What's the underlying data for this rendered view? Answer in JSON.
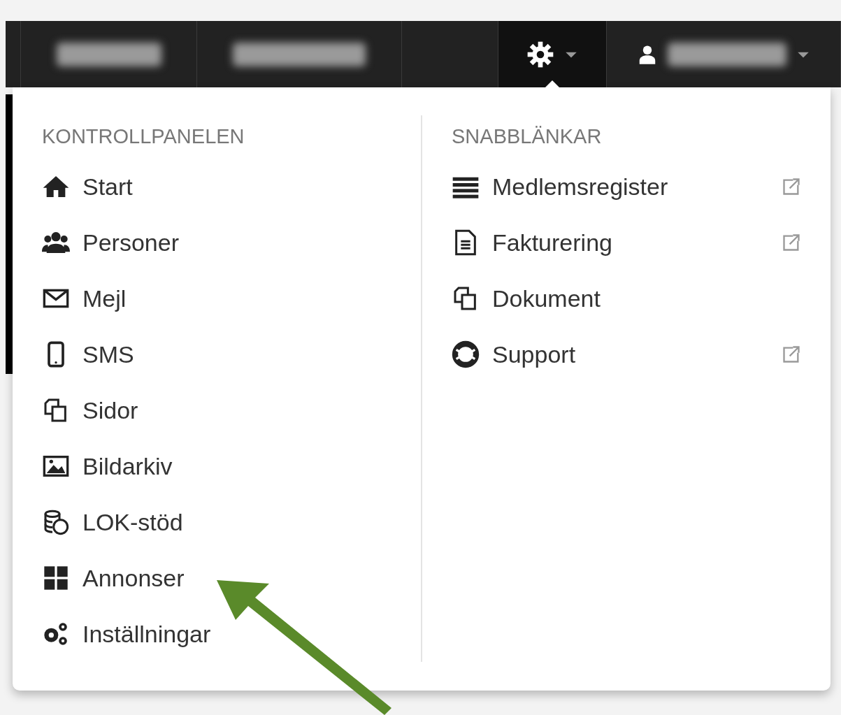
{
  "navbar": {
    "items": [
      {
        "kind": "blurred",
        "selected": false
      },
      {
        "kind": "blurred",
        "selected": false
      },
      {
        "kind": "empty",
        "selected": false
      },
      {
        "kind": "gear",
        "selected": true
      },
      {
        "kind": "user",
        "selected": false
      }
    ]
  },
  "dropdown": {
    "columns": [
      {
        "heading": "KONTROLLPANELEN",
        "items": [
          {
            "label": "Start"
          },
          {
            "label": "Personer"
          },
          {
            "label": "Mejl"
          },
          {
            "label": "SMS"
          },
          {
            "label": "Sidor"
          },
          {
            "label": "Bildarkiv"
          },
          {
            "label": "LOK-stöd"
          },
          {
            "label": "Annonser"
          },
          {
            "label": "Inställningar"
          }
        ]
      },
      {
        "heading": "SNABBLÄNKAR",
        "items": [
          {
            "label": "Medlemsregister",
            "external": true
          },
          {
            "label": "Fakturering",
            "external": true
          },
          {
            "label": "Dokument",
            "external": false
          },
          {
            "label": "Support",
            "external": true
          }
        ]
      }
    ]
  }
}
